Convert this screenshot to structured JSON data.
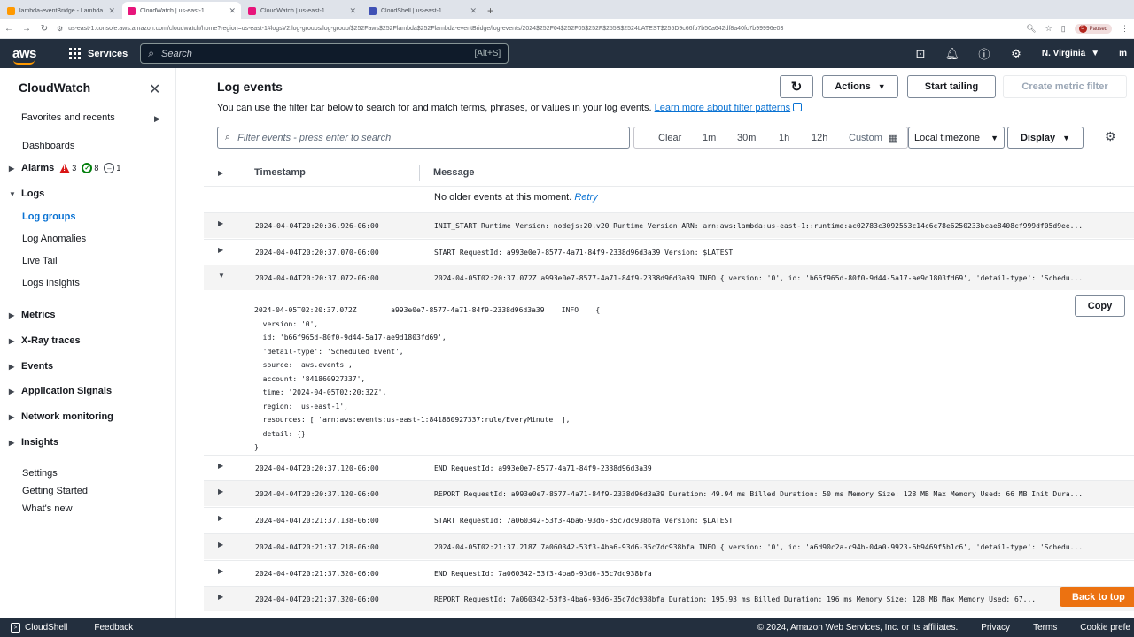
{
  "browser": {
    "tabs": [
      {
        "label": "lambda-eventBridge - Lambda",
        "color": "#ff9900",
        "active": false
      },
      {
        "label": "CloudWatch | us-east-1",
        "color": "#e7157b",
        "active": true
      },
      {
        "label": "CloudWatch | us-east-1",
        "color": "#e7157b",
        "active": false
      },
      {
        "label": "CloudShell | us-east-1",
        "color": "#3f51b5",
        "active": false
      }
    ],
    "url": "us-east-1.console.aws.amazon.com/cloudwatch/home?region=us-east-1#logsV2:log-groups/log-group/$252Faws$252Flambda$252Flambda-eventBridge/log-events/2024$252F04$252F05$252F$255B$2524LATEST$255D9c66fb7b50a642df8a40fc7b99996e03",
    "paused_label": "Paused",
    "paused_initial": "S"
  },
  "aws_header": {
    "logo": "aws",
    "services_label": "Services",
    "search_placeholder": "Search",
    "search_shortcut": "[Alt+S]",
    "region_label": "N. Virginia",
    "account_initial": "m"
  },
  "sidebar": {
    "title": "CloudWatch",
    "favorites": "Favorites and recents",
    "dashboards": "Dashboards",
    "alarms": {
      "label": "Alarms",
      "in_alarm": "3",
      "ok": "8",
      "insufficient": "1"
    },
    "logs": "Logs",
    "log_items": [
      "Log groups",
      "Log Anomalies",
      "Live Tail",
      "Logs Insights"
    ],
    "sections": [
      "Metrics",
      "X-Ray traces",
      "Events",
      "Application Signals",
      "Network monitoring",
      "Insights"
    ],
    "bottom_links": [
      "Settings",
      "Getting Started",
      "What's new"
    ]
  },
  "main": {
    "title": "Log events",
    "description": "You can use the filter bar below to search for and match terms, phrases, or values in your log events.",
    "learn_more": "Learn more about filter patterns",
    "buttons": {
      "actions": "Actions",
      "start_tailing": "Start tailing",
      "create_metric_filter": "Create metric filter"
    },
    "filter_placeholder": "Filter events - press enter to search",
    "ranges": [
      "Clear",
      "1m",
      "30m",
      "1h",
      "12h",
      "Custom"
    ],
    "timezone": "Local timezone",
    "display": "Display",
    "columns": {
      "timestamp": "Timestamp",
      "message": "Message"
    },
    "no_older": "No older events at this moment.",
    "retry": "Retry",
    "rows": [
      {
        "ts": "2024-04-04T20:20:36.926-06:00",
        "msg": "INIT_START Runtime Version: nodejs:20.v20 Runtime Version ARN: arn:aws:lambda:us-east-1::runtime:ac02783c3092553c14c6c78e6250233bcae8408cf999df05d9ee..."
      },
      {
        "ts": "2024-04-04T20:20:37.070-06:00",
        "msg": "START RequestId: a993e0e7-8577-4a71-84f9-2338d96d3a39 Version: $LATEST"
      },
      {
        "ts": "2024-04-04T20:20:37.072-06:00",
        "msg": "2024-04-05T02:20:37.072Z a993e0e7-8577-4a71-84f9-2338d96d3a39 INFO { version: '0', id: 'b66f965d-80f0-9d44-5a17-ae9d1803fd69', 'detail-type': 'Schedu..."
      },
      {
        "ts": "2024-04-04T20:20:37.120-06:00",
        "msg": "END RequestId: a993e0e7-8577-4a71-84f9-2338d96d3a39"
      },
      {
        "ts": "2024-04-04T20:20:37.120-06:00",
        "msg": "REPORT RequestId: a993e0e7-8577-4a71-84f9-2338d96d3a39 Duration: 49.94 ms Billed Duration: 50 ms Memory Size: 128 MB Max Memory Used: 66 MB Init Dura..."
      },
      {
        "ts": "2024-04-04T20:21:37.138-06:00",
        "msg": "START RequestId: 7a060342-53f3-4ba6-93d6-35c7dc938bfa Version: $LATEST"
      },
      {
        "ts": "2024-04-04T20:21:37.218-06:00",
        "msg": "2024-04-05T02:21:37.218Z 7a060342-53f3-4ba6-93d6-35c7dc938bfa INFO { version: '0', id: 'a6d90c2a-c94b-04a0-9923-6b9469f5b1c6', 'detail-type': 'Schedu..."
      },
      {
        "ts": "2024-04-04T20:21:37.320-06:00",
        "msg": "END RequestId: 7a060342-53f3-4ba6-93d6-35c7dc938bfa"
      },
      {
        "ts": "2024-04-04T20:21:37.320-06:00",
        "msg": "REPORT RequestId: 7a060342-53f3-4ba6-93d6-35c7dc938bfa Duration: 195.93 ms Billed Duration: 196 ms Memory Size: 128 MB Max Memory Used: 67..."
      }
    ],
    "expanded_text": "2024-04-05T02:20:37.072Z        a993e0e7-8577-4a71-84f9-2338d96d3a39    INFO    {\n  version: '0',\n  id: 'b66f965d-80f0-9d44-5a17-ae9d1803fd69',\n  'detail-type': 'Scheduled Event',\n  source: 'aws.events',\n  account: '841860927337',\n  time: '2024-04-05T02:20:32Z',\n  region: 'us-east-1',\n  resources: [ 'arn:aws:events:us-east-1:841860927337:rule/EveryMinute' ],\n  detail: {}\n}",
    "copy": "Copy",
    "back_to_top": "Back to top"
  },
  "footer": {
    "cloudshell": "CloudShell",
    "feedback": "Feedback",
    "copyright": "© 2024, Amazon Web Services, Inc. or its affiliates.",
    "privacy": "Privacy",
    "terms": "Terms",
    "cookie": "Cookie prefe"
  }
}
